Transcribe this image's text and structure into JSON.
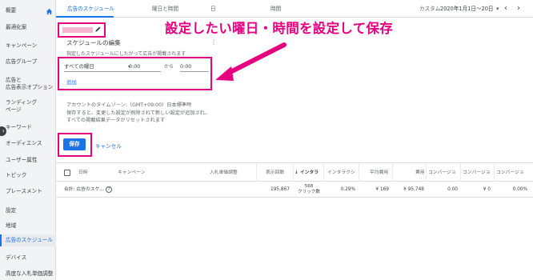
{
  "sidebar": {
    "items": [
      {
        "label": "概要"
      },
      {
        "label": "最適化案"
      },
      {
        "label": "キャンペーン"
      },
      {
        "label": "広告グループ"
      },
      {
        "label": "広告と\n広告表示オプション"
      },
      {
        "label": "ランディング\nページ"
      },
      {
        "label": "キーワード"
      },
      {
        "label": "オーディエンス"
      },
      {
        "label": "ユーザー属性"
      },
      {
        "label": "トピック"
      },
      {
        "label": "プレースメント"
      },
      {
        "label": "設定"
      },
      {
        "label": "地域"
      },
      {
        "label": "広告のスケジュール"
      },
      {
        "label": "デバイス"
      },
      {
        "label": "高度な入札単価調整"
      }
    ],
    "active_label": "広告のスケジュール"
  },
  "tabs": [
    {
      "label": "広告のスケジュール"
    },
    {
      "label": "曜日と時間"
    },
    {
      "label": "日"
    },
    {
      "label": "時間"
    }
  ],
  "date_range": {
    "label": "カスタム",
    "value": "2020年1月1日〜20日"
  },
  "editor": {
    "heading": "スケジュールの編集",
    "description": "指定したスケジュールにしたがって広告が掲載されます",
    "day_value": "すべての曜日",
    "start_time": "0:00",
    "separator": "から",
    "end_time": "0:00",
    "add_label": "追加",
    "tz_line1": "アカウントのタイムゾーン:（GMT+09:00）日本標準時",
    "tz_line2": "保存すると、変更した設定が削除されて新しい設定が追加され、",
    "tz_line3": "すべての掲載結果データがリセットされます",
    "save_label": "保存",
    "cancel_label": "キャンセル"
  },
  "callout": {
    "text": "設定したい曜日・時間を設定して保存"
  },
  "colors": {
    "accent": "#1a73e8",
    "highlight": "#e4007f"
  },
  "table": {
    "headers": [
      "日時",
      "キャンペーン",
      "入札単価調整",
      "表示回数",
      "↓ インタラ",
      "インタラクシ",
      "平均費用",
      "費用",
      "コンバージョ",
      "コンバージョ",
      "コンバージョ"
    ],
    "total_row": {
      "label": "合計: 広告のスケ…",
      "impressions": "195,867",
      "interactions_line1": "568",
      "interactions_line2": "クリック数",
      "interaction_rate": "0.29%",
      "avg_cost": "¥ 169",
      "cost": "¥ 95,748",
      "conv": "0.00",
      "conv_value": "¥ 0",
      "conv_rate": "0.00%"
    }
  }
}
